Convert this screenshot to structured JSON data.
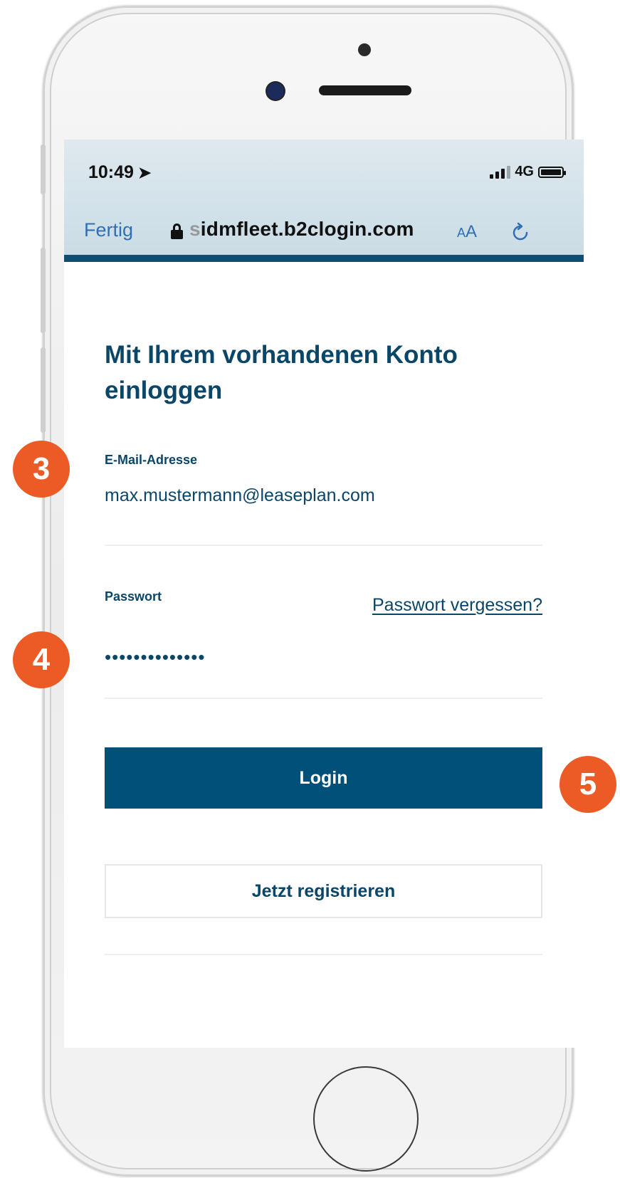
{
  "status_bar": {
    "time": "10:49",
    "network": "4G"
  },
  "browser": {
    "done_label": "Fertig",
    "domain_prefix": "s",
    "domain": "idmfleet.b2clogin.com",
    "text_size_small": "A",
    "text_size_large": "A"
  },
  "login": {
    "heading": "Mit Ihrem vorhandenen Konto einloggen",
    "email_label": "E-Mail-Adresse",
    "email_value": "max.mustermann@leaseplan.com",
    "password_label": "Passwort",
    "forgot_password": "Passwort vergessen?",
    "password_value": "••••••••••••••",
    "login_button": "Login",
    "register_button": "Jetzt registrieren"
  },
  "steps": [
    "3",
    "4",
    "5"
  ],
  "colors": {
    "brand": "#00507a",
    "step_badge": "#ec5b26",
    "link": "#2f6fb2"
  }
}
